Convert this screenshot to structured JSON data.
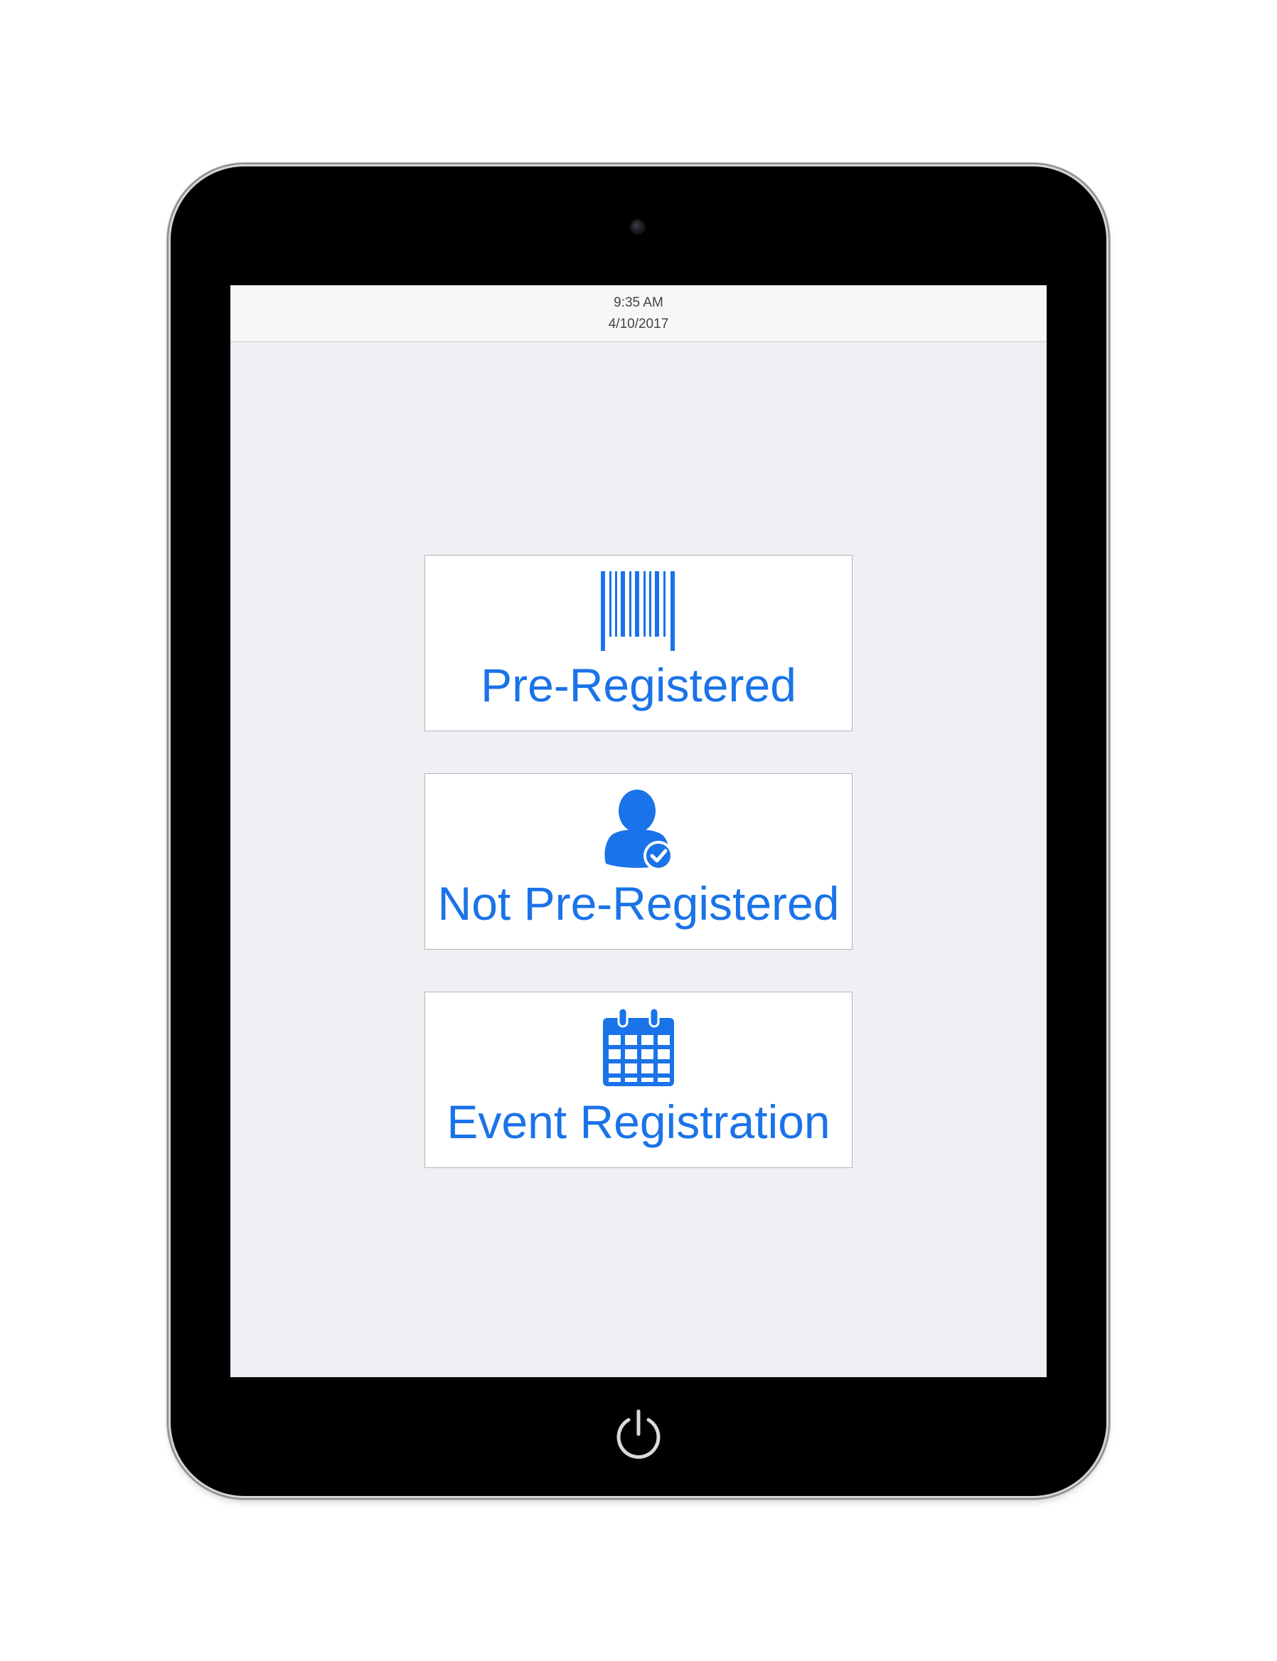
{
  "status_bar": {
    "time": "9:35 AM",
    "date": "4/10/2017"
  },
  "menu": {
    "items": [
      {
        "label": "Pre-Registered",
        "icon": "barcode-icon"
      },
      {
        "label": "Not Pre-Registered",
        "icon": "user-check-icon"
      },
      {
        "label": "Event Registration",
        "icon": "calendar-icon"
      }
    ]
  },
  "device": {
    "home_button_icon": "power-icon"
  },
  "colors": {
    "accent": "#1a73e8",
    "screen_background": "#efeff4",
    "tile_background": "#ffffff",
    "bezel": "#000000"
  }
}
